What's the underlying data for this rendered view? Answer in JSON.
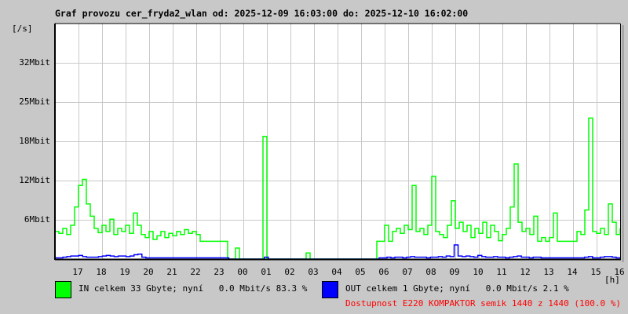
{
  "title": "Graf provozu cer_fryda2_wlan od: 2025-12-09 16:03:00 do: 2025-12-10 16:02:00",
  "colors": {
    "in": "#00ff00",
    "out": "#0000ff",
    "availability": "#ff0000",
    "grid": "#c8c8c8"
  },
  "legend": {
    "in": "IN celkem 33 Gbyte; nyní   0.0 Mbit/s 83.3 %",
    "out": "OUT celkem 1 Gbyte; nyní   0.0 Mbit/s 2.1 %",
    "availability": "Dostupnost E220 KOMPAKTOR semik 1440 z 1440 (100.0 %)"
  },
  "chart_data": {
    "type": "line",
    "title": "Graf provozu cer_fryda2_wlan od: 2025-12-09 16:03:00 do: 2025-12-10 16:02:00",
    "ylabel": "[/s]",
    "xlabel": "[h]",
    "ylim": [
      0,
      38.4
    ],
    "y_unit": "Mbit/s",
    "y_ticks": [
      {
        "value": 6.4,
        "label": "6Mbit"
      },
      {
        "value": 12.8,
        "label": "12Mbit"
      },
      {
        "value": 19.2,
        "label": "18Mbit"
      },
      {
        "value": 25.6,
        "label": "25Mbit"
      },
      {
        "value": 32,
        "label": "32Mbit"
      }
    ],
    "x_ticks": [
      "17",
      "18",
      "19",
      "20",
      "21",
      "22",
      "23",
      "00",
      "01",
      "02",
      "03",
      "04",
      "05",
      "06",
      "07",
      "08",
      "09",
      "10",
      "11",
      "12",
      "13",
      "14",
      "15",
      "16"
    ],
    "x_sample_minutes": 10,
    "grid": true,
    "series": [
      {
        "name": "IN",
        "color": "#00ff00",
        "values": [
          4.5,
          4.2,
          5.0,
          4.0,
          5.5,
          8.5,
          12,
          13,
          9,
          7,
          5,
          4.3,
          5.5,
          4.5,
          6.5,
          4.0,
          5.0,
          4.5,
          5.5,
          4.2,
          7.5,
          5.5,
          4.0,
          3.5,
          4.5,
          3.2,
          3.8,
          4.5,
          3.5,
          4.2,
          3.8,
          4.5,
          4.0,
          4.8,
          4.2,
          4.5,
          4.0,
          2.9,
          2.9,
          2.9,
          2.9,
          2.9,
          2.9,
          2.9,
          0,
          0,
          1.8,
          0,
          0,
          0,
          0,
          0,
          0,
          20,
          0,
          0,
          0,
          0,
          0,
          0,
          0,
          0,
          0,
          0,
          1.0,
          0,
          0,
          0,
          0,
          0,
          0,
          0,
          0,
          0,
          0,
          0,
          0,
          0,
          0,
          0,
          0,
          0,
          2.9,
          2.9,
          5.5,
          2.9,
          4.5,
          5.0,
          4.2,
          5.5,
          4.8,
          12,
          4.5,
          5.0,
          4.0,
          5.5,
          13.5,
          4.5,
          4.0,
          3.5,
          5.5,
          9.5,
          5.0,
          6.0,
          4.5,
          5.5,
          3.5,
          5.0,
          4.2,
          6.0,
          3.5,
          5.5,
          4.5,
          3.0,
          4.0,
          5.0,
          8.5,
          15.5,
          6.0,
          4.5,
          5.0,
          4.0,
          7.0,
          2.9,
          3.5,
          2.9,
          3.5,
          7.5,
          2.9,
          2.9,
          2.9,
          2.9,
          2.9,
          4.5,
          4.0,
          8,
          23,
          4.5,
          4.2,
          5.0,
          4.0,
          9.0,
          6.0,
          4.0,
          5.0
        ]
      },
      {
        "name": "OUT",
        "color": "#0000ff",
        "values": [
          0.2,
          0.2,
          0.3,
          0.4,
          0.5,
          0.5,
          0.6,
          0.4,
          0.3,
          0.3,
          0.3,
          0.4,
          0.5,
          0.6,
          0.5,
          0.4,
          0.5,
          0.5,
          0.4,
          0.5,
          0.7,
          0.8,
          0.3,
          0.2,
          0.2,
          0.2,
          0.2,
          0.2,
          0.2,
          0.2,
          0.2,
          0.2,
          0.2,
          0.2,
          0.2,
          0.2,
          0.2,
          0.2,
          0.2,
          0.2,
          0.2,
          0.2,
          0.2,
          0.2,
          0,
          0,
          0,
          0,
          0,
          0,
          0,
          0,
          0,
          0.3,
          0,
          0,
          0,
          0,
          0,
          0,
          0,
          0,
          0,
          0,
          0,
          0,
          0,
          0,
          0,
          0,
          0,
          0,
          0,
          0,
          0,
          0,
          0,
          0,
          0,
          0,
          0,
          0,
          0.2,
          0.2,
          0.3,
          0.2,
          0.3,
          0.3,
          0.2,
          0.3,
          0.4,
          0.3,
          0.3,
          0.3,
          0.2,
          0.3,
          0.3,
          0.4,
          0.3,
          0.5,
          0.4,
          2.3,
          0.5,
          0.4,
          0.5,
          0.4,
          0.3,
          0.6,
          0.4,
          0.3,
          0.3,
          0.4,
          0.3,
          0.3,
          0.2,
          0.3,
          0.4,
          0.5,
          0.3,
          0.3,
          0.2,
          0.3,
          0.3,
          0.2,
          0.2,
          0.2,
          0.2,
          0.2,
          0.2,
          0.2,
          0.2,
          0.2,
          0.2,
          0.2,
          0.3,
          0.4,
          0.2,
          0.2,
          0.3,
          0.4,
          0.4,
          0.3,
          0.2,
          0.3
        ]
      }
    ]
  }
}
